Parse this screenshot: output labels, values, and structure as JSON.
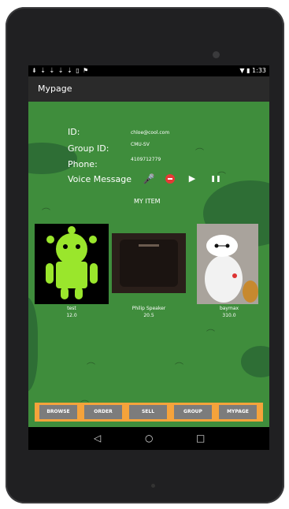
{
  "status_bar": {
    "time": "1:33",
    "left_icons": "⇟ ⇣ ⇣ ⇣ ⇣ ▯ ⚑"
  },
  "action_bar": {
    "title": "Mypage"
  },
  "profile": {
    "id_label": "ID:",
    "id_value": "chloe@cool.com",
    "group_label": "Group ID:",
    "group_value": "CMU-SV",
    "phone_label": "Phone:",
    "phone_value": "4109712779",
    "voice_label": "Voice Message"
  },
  "controls": {
    "mic": "🎤",
    "play": "▶",
    "pause": "❚❚"
  },
  "section_title": "MY ITEM",
  "items": [
    {
      "name": "test",
      "price": "12.0"
    },
    {
      "name": "Philip Speaker",
      "price": "20.5"
    },
    {
      "name": "baymax",
      "price": "310.0"
    }
  ],
  "tabs": [
    "BROWSE",
    "ORDER",
    "SELL",
    "GROUP",
    "MYPAGE"
  ],
  "nav": {
    "back": "◁",
    "home": "○",
    "recent": "□"
  },
  "colors": {
    "accent_orange": "#f5a33b",
    "tab_gray": "#7c7c7c",
    "background_green": "#3f8d3c"
  }
}
